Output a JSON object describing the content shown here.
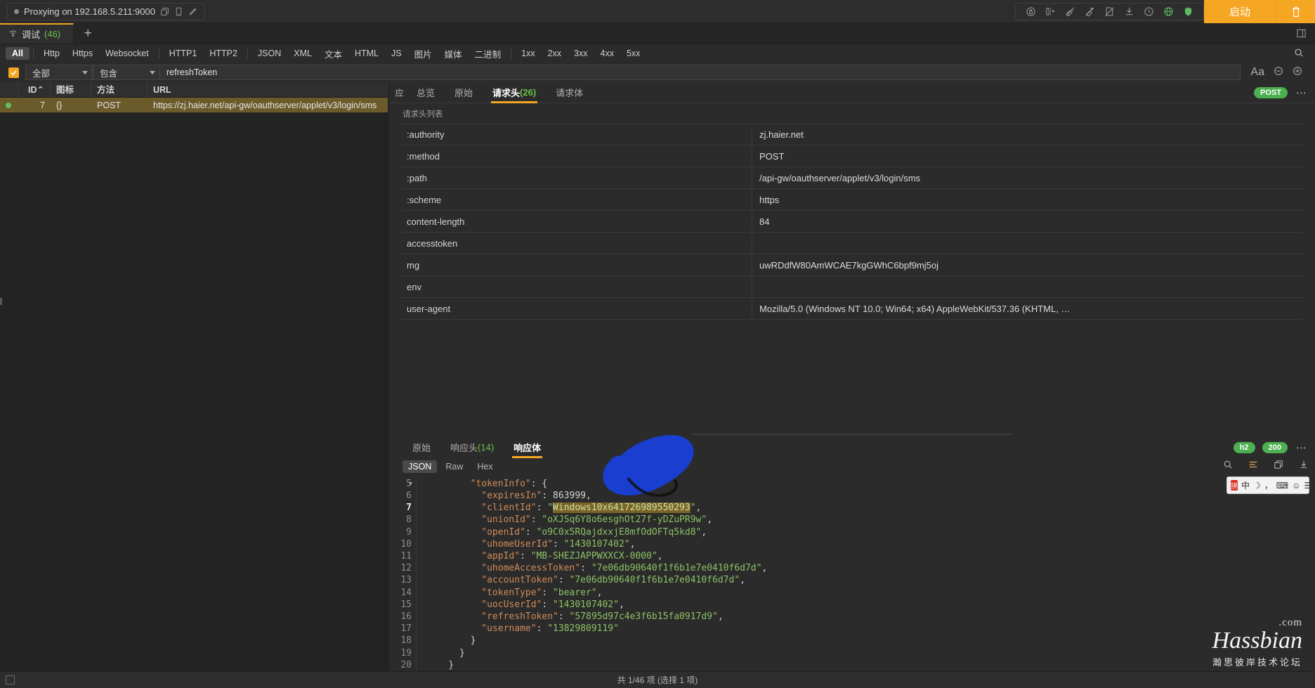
{
  "titlebar": {
    "proxy_status": "Proxying on 192.168.5.211:9000",
    "copy_icon": "copy-icon",
    "phone_icon": "phone-icon",
    "edit_icon": "edit-icon",
    "start_label": "启动",
    "trash_icon": "trash-icon",
    "accent_color": "#f5a623"
  },
  "tabstrip": {
    "session_tab": "调试",
    "session_count": "(46)",
    "add_label": "+"
  },
  "chips": {
    "groups": [
      [
        "All"
      ],
      [
        "Http",
        "Https",
        "Websocket"
      ],
      [
        "HTTP1",
        "HTTP2"
      ],
      [
        "JSON",
        "XML",
        "文本",
        "HTML",
        "JS",
        "图片",
        "媒体",
        "二进制"
      ],
      [
        "1xx",
        "2xx",
        "3xx",
        "4xx",
        "5xx"
      ]
    ],
    "active": "All"
  },
  "filterbar": {
    "scope_value": "全部",
    "match_value": "包含",
    "search_value": "refreshToken",
    "search_placeholder": "",
    "case_label": "Aa",
    "minus_label": "−",
    "plus_label": "+"
  },
  "request_table": {
    "columns": [
      "",
      "ID",
      "图标",
      "方法",
      "URL"
    ],
    "sort_indicator": "⌃",
    "rows": [
      {
        "status": "ok",
        "id": "7",
        "icon": "{}",
        "method": "POST",
        "url": "https://zj.haier.net/api-gw/oauthserver/applet/v3/login/sms",
        "selected": true
      }
    ]
  },
  "request_pane": {
    "side_label": "应",
    "tabs": [
      {
        "label": "总览",
        "count": "",
        "active": false
      },
      {
        "label": "原始",
        "count": "",
        "active": false
      },
      {
        "label": "请求头",
        "count": "(26)",
        "active": true
      },
      {
        "label": "请求体",
        "count": "",
        "active": false
      }
    ],
    "method_badge": "POST",
    "section_label": "请求头列表",
    "headers": [
      {
        "name": ":authority",
        "value": "zj.haier.net"
      },
      {
        "name": ":method",
        "value": "POST"
      },
      {
        "name": ":path",
        "value": "/api-gw/oauthserver/applet/v3/login/sms"
      },
      {
        "name": ":scheme",
        "value": "https"
      },
      {
        "name": "content-length",
        "value": "84"
      },
      {
        "name": "accesstoken",
        "value": ""
      },
      {
        "name": "mg",
        "value": "uwRDdfW80AmWCAE7kgGWhC6bpf9mj5oj"
      },
      {
        "name": "env",
        "value": ""
      },
      {
        "name": "user-agent",
        "value": "Mozilla/5.0 (Windows NT 10.0; Win64; x64) AppleWebKit/537.36 (KHTML, …"
      }
    ]
  },
  "response_pane": {
    "tabs": [
      {
        "label": "原始",
        "count": "",
        "active": false
      },
      {
        "label": "响应头",
        "count": "(14)",
        "active": false
      },
      {
        "label": "响应体",
        "count": "",
        "active": true
      }
    ],
    "protocol_badge": "h2",
    "status_badge": "200",
    "view_tabs": [
      {
        "label": "JSON",
        "active": true
      },
      {
        "label": "Raw",
        "active": false
      },
      {
        "label": "Hex",
        "active": false
      }
    ],
    "json_lines": [
      {
        "num": "5",
        "indent": 4,
        "foldable": true,
        "tokens": [
          {
            "t": "k",
            "v": "\"tokenInfo\""
          },
          {
            "t": "p",
            "v": ": {"
          }
        ]
      },
      {
        "num": "6",
        "indent": 5,
        "foldable": false,
        "tokens": [
          {
            "t": "k",
            "v": "\"expiresIn\""
          },
          {
            "t": "p",
            "v": ": "
          },
          {
            "t": "n",
            "v": "863999"
          },
          {
            "t": "p",
            "v": ","
          }
        ]
      },
      {
        "num": "7",
        "indent": 5,
        "foldable": false,
        "current": true,
        "tokens": [
          {
            "t": "k",
            "v": "\"clientId\""
          },
          {
            "t": "p",
            "v": ": "
          },
          {
            "t": "s",
            "v": "\""
          },
          {
            "t": "hl",
            "v": "Windows10x641726989550293"
          },
          {
            "t": "s",
            "v": "\""
          },
          {
            "t": "p",
            "v": ","
          }
        ]
      },
      {
        "num": "8",
        "indent": 5,
        "foldable": false,
        "tokens": [
          {
            "t": "k",
            "v": "\"unionId\""
          },
          {
            "t": "p",
            "v": ": "
          },
          {
            "t": "s",
            "v": "\"oXJSq6Y8o6esghOt27f-yDZuPR9w\""
          },
          {
            "t": "p",
            "v": ","
          }
        ]
      },
      {
        "num": "9",
        "indent": 5,
        "foldable": false,
        "tokens": [
          {
            "t": "k",
            "v": "\"openId\""
          },
          {
            "t": "p",
            "v": ": "
          },
          {
            "t": "s",
            "v": "\"o9C0x5RQajdxxjE8mfOdOFTq5kd8\""
          },
          {
            "t": "p",
            "v": ","
          }
        ]
      },
      {
        "num": "10",
        "indent": 5,
        "foldable": false,
        "tokens": [
          {
            "t": "k",
            "v": "\"uhomeUserId\""
          },
          {
            "t": "p",
            "v": ": "
          },
          {
            "t": "s",
            "v": "\"1430107402\""
          },
          {
            "t": "p",
            "v": ","
          }
        ]
      },
      {
        "num": "11",
        "indent": 5,
        "foldable": false,
        "tokens": [
          {
            "t": "k",
            "v": "\"appId\""
          },
          {
            "t": "p",
            "v": ": "
          },
          {
            "t": "s",
            "v": "\"MB-SHEZJAPPWXXCX-0000\""
          },
          {
            "t": "p",
            "v": ","
          }
        ]
      },
      {
        "num": "12",
        "indent": 5,
        "foldable": false,
        "tokens": [
          {
            "t": "k",
            "v": "\"uhomeAccessToken\""
          },
          {
            "t": "p",
            "v": ": "
          },
          {
            "t": "s",
            "v": "\"7e06db90640f1f6b1e7e0410f6d7d\""
          },
          {
            "t": "p",
            "v": ","
          }
        ]
      },
      {
        "num": "13",
        "indent": 5,
        "foldable": false,
        "tokens": [
          {
            "t": "k",
            "v": "\"accountToken\""
          },
          {
            "t": "p",
            "v": ": "
          },
          {
            "t": "s",
            "v": "\"7e06db90640f1f6b1e7e0410f6d7d\""
          },
          {
            "t": "p",
            "v": ","
          }
        ]
      },
      {
        "num": "14",
        "indent": 5,
        "foldable": false,
        "tokens": [
          {
            "t": "k",
            "v": "\"tokenType\""
          },
          {
            "t": "p",
            "v": ": "
          },
          {
            "t": "s",
            "v": "\"bearer\""
          },
          {
            "t": "p",
            "v": ","
          }
        ]
      },
      {
        "num": "15",
        "indent": 5,
        "foldable": false,
        "tokens": [
          {
            "t": "k",
            "v": "\"uocUserId\""
          },
          {
            "t": "p",
            "v": ": "
          },
          {
            "t": "s",
            "v": "\"1430107402\""
          },
          {
            "t": "p",
            "v": ","
          }
        ]
      },
      {
        "num": "16",
        "indent": 5,
        "foldable": false,
        "tokens": [
          {
            "t": "k",
            "v": "\"refreshToken\""
          },
          {
            "t": "p",
            "v": ": "
          },
          {
            "t": "s",
            "v": "\"57895d97c4e3f6b15fa0917d9\""
          },
          {
            "t": "p",
            "v": ","
          }
        ]
      },
      {
        "num": "17",
        "indent": 5,
        "foldable": false,
        "tokens": [
          {
            "t": "k",
            "v": "\"username\""
          },
          {
            "t": "p",
            "v": ": "
          },
          {
            "t": "s",
            "v": "\"13829809119\""
          }
        ]
      },
      {
        "num": "18",
        "indent": 4,
        "foldable": false,
        "tokens": [
          {
            "t": "p",
            "v": "}"
          }
        ]
      },
      {
        "num": "19",
        "indent": 3,
        "foldable": false,
        "tokens": [
          {
            "t": "p",
            "v": "}"
          }
        ]
      },
      {
        "num": "20",
        "indent": 2,
        "foldable": false,
        "tokens": [
          {
            "t": "p",
            "v": "}"
          }
        ]
      }
    ]
  },
  "statusbar": {
    "summary": "共 1/46 项 (选择 1 项)"
  },
  "overlays": {
    "ime_lang": "中",
    "watermark_domain": ".com",
    "watermark_name": "Hassbian",
    "watermark_sub": "瀚思彼岸技术论坛"
  }
}
